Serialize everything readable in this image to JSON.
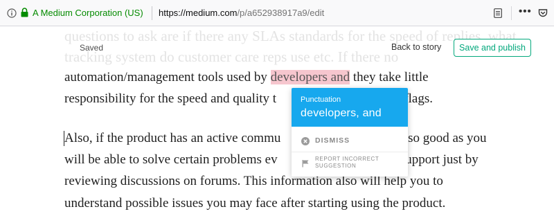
{
  "browser": {
    "cert_owner": "A Medium Corporation (US)",
    "url_base": "https://medium.com",
    "url_path": "/p/a652938917a9/edit",
    "more_glyph": "•••"
  },
  "editor": {
    "status": "Saved",
    "back_link": "Back to story",
    "publish_label": "Save and publish",
    "accent_color": "#03a87c"
  },
  "content": {
    "ghost_line_1": "questions to ask are if there any SLAs standards for the speed of replies, what",
    "ghost_line_2": "tracking system do customer care reps use etc. If there no",
    "p1_l1_before": "automation/management tools used by ",
    "p1_l1_highlight": "developers and",
    "p1_l1_after": " they take little",
    "p1_l2_before": "responsibility for the speed and quality t",
    "p1_l2_after": "d flags.",
    "p2_l1_before": "Also, if the product has an active commu",
    "p2_l1_after": "also good as you",
    "p2_l2_before": "will be able to solve certain problems ev",
    "p2_l2_after": "g support just by",
    "p2_l3": "reviewing discussions on forums. This information also will help you to",
    "p2_l4": "understand possible issues you may face after starting using the product."
  },
  "popup": {
    "category": "Punctuation",
    "suggestion": "developers, and",
    "dismiss_label": "DISMISS",
    "report_label": "REPORT INCORRECT SUGGESTION",
    "accent_color": "#17a8ee"
  }
}
